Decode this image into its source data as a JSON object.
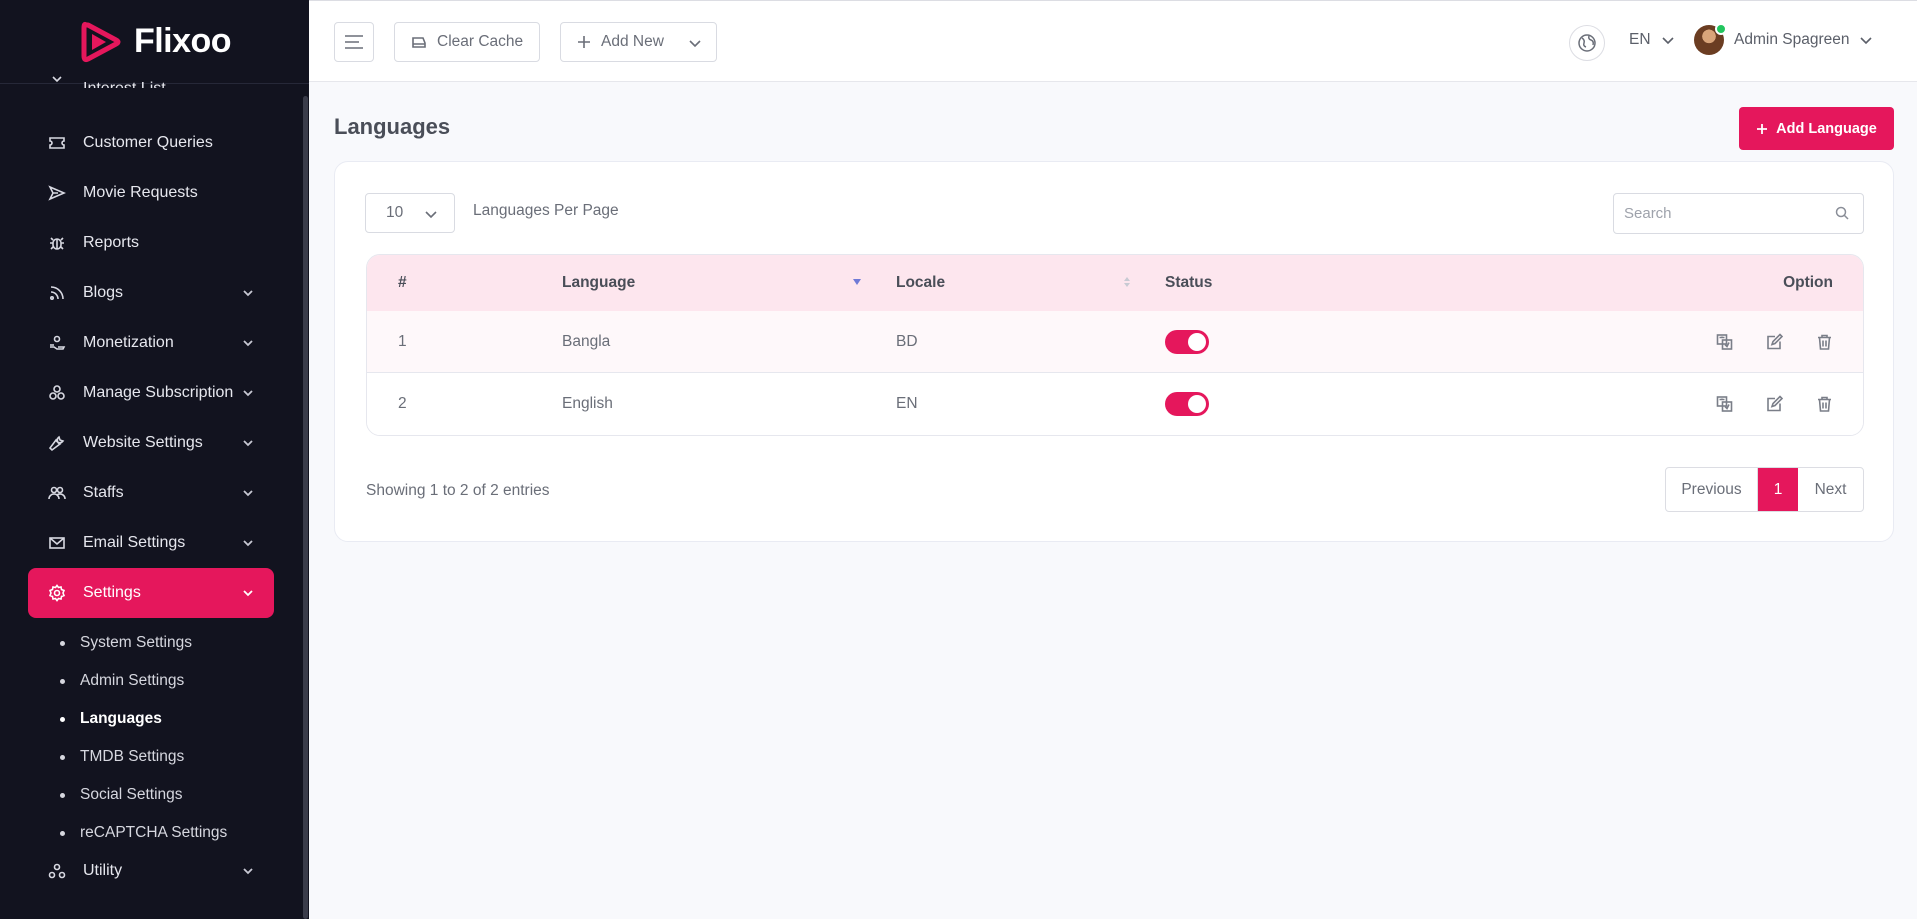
{
  "brand": {
    "name": "Flixoo",
    "accent": "#e5175c"
  },
  "sidebar": {
    "partial_item": "Interest List",
    "items": [
      {
        "label": "Customer Queries",
        "icon": "ticket-icon",
        "has_children": false
      },
      {
        "label": "Movie Requests",
        "icon": "send-icon",
        "has_children": false
      },
      {
        "label": "Reports",
        "icon": "bug-icon",
        "has_children": false
      },
      {
        "label": "Blogs",
        "icon": "rss-icon",
        "has_children": true
      },
      {
        "label": "Monetization",
        "icon": "hand-coin-icon",
        "has_children": true
      },
      {
        "label": "Manage Subscription",
        "icon": "stack-icon",
        "has_children": true
      },
      {
        "label": "Website Settings",
        "icon": "wrench-icon",
        "has_children": true
      },
      {
        "label": "Staffs",
        "icon": "users-icon",
        "has_children": true
      },
      {
        "label": "Email Settings",
        "icon": "mail-icon",
        "has_children": true
      },
      {
        "label": "Settings",
        "icon": "gear-icon",
        "has_children": true,
        "active": true
      }
    ],
    "sub_items": [
      {
        "label": "System Settings"
      },
      {
        "label": "Admin Settings"
      },
      {
        "label": "Languages",
        "current": true
      },
      {
        "label": "TMDB Settings"
      },
      {
        "label": "Social Settings"
      },
      {
        "label": "reCAPTCHA Settings"
      }
    ],
    "after_items": [
      {
        "label": "Utility",
        "icon": "utility-icon",
        "has_children": true
      }
    ]
  },
  "topbar": {
    "clear_cache": "Clear Cache",
    "add_new": "Add New",
    "language": "EN",
    "user_name": "Admin Spagreen"
  },
  "main": {
    "title": "Languages",
    "add_button": "Add Language",
    "per_page_value": "10",
    "per_page_label": "Languages Per Page",
    "search_placeholder": "Search",
    "table": {
      "headers": {
        "num": "#",
        "language": "Language",
        "locale": "Locale",
        "status": "Status",
        "option": "Option"
      },
      "rows": [
        {
          "num": "1",
          "language": "Bangla",
          "locale": "BD",
          "status": true
        },
        {
          "num": "2",
          "language": "English",
          "locale": "EN",
          "status": true
        }
      ]
    },
    "showing": "Showing 1 to 2 of 2 entries",
    "pagination": {
      "previous": "Previous",
      "current": "1",
      "next": "Next"
    }
  }
}
